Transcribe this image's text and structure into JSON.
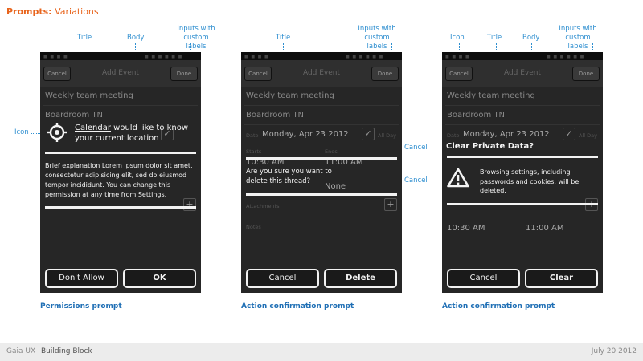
{
  "page": {
    "title_bold": "Prompts:",
    "title_rest": "Variations"
  },
  "annotations": {
    "title": "Title",
    "body": "Body",
    "icon": "Icon",
    "inputs": "Inputs with custom labels",
    "cancel": "Cancel"
  },
  "background_form": {
    "cancel": "Cancel",
    "header": "Add Event",
    "done": "Done",
    "event_name": "Weekly team meeting",
    "location": "Boardroom TN",
    "date_label": "Date",
    "date_value": "Monday, Apr 23 2012",
    "allday": "All Day",
    "starts": "Starts",
    "ends": "Ends",
    "start_time": "10:30 AM",
    "end_time": "11:00 AM",
    "reminder_label": "Reminder",
    "reminder_value": "None",
    "attachments": "Attachments",
    "notes": "Notes"
  },
  "panels": [
    {
      "caption": "Permissions prompt",
      "title_link": "Calendar",
      "title_rest": "would like to know",
      "title_line2": "your current location",
      "body": "Brief explanation Lorem ipsum dolor sit amet, consectetur adipisicing elit, sed do eiusmod tempor incididunt. You can change this permission at any time from Settings.",
      "button_left": "Don't Allow",
      "button_right": "OK"
    },
    {
      "caption": "Action confirmation prompt",
      "body": "Are you sure you want to delete this thread?",
      "button_left": "Cancel",
      "button_right": "Delete"
    },
    {
      "caption": "Action confirmation prompt",
      "title": "Clear Private Data?",
      "body": "Browsing settings, including passwords and cookies, will be deleted.",
      "button_left": "Cancel",
      "button_right": "Clear"
    }
  ],
  "footer": {
    "product": "Gaia UX",
    "section": "Building Block",
    "date": "July 20 2012"
  },
  "colors": {
    "accent": "#e8641c",
    "annotation": "#2f8fd0",
    "caption": "#1f6fb5",
    "phone_bg": "#262626"
  },
  "icons": [
    "target-icon",
    "warning-icon",
    "plus-icon",
    "checkmark-icon"
  ]
}
